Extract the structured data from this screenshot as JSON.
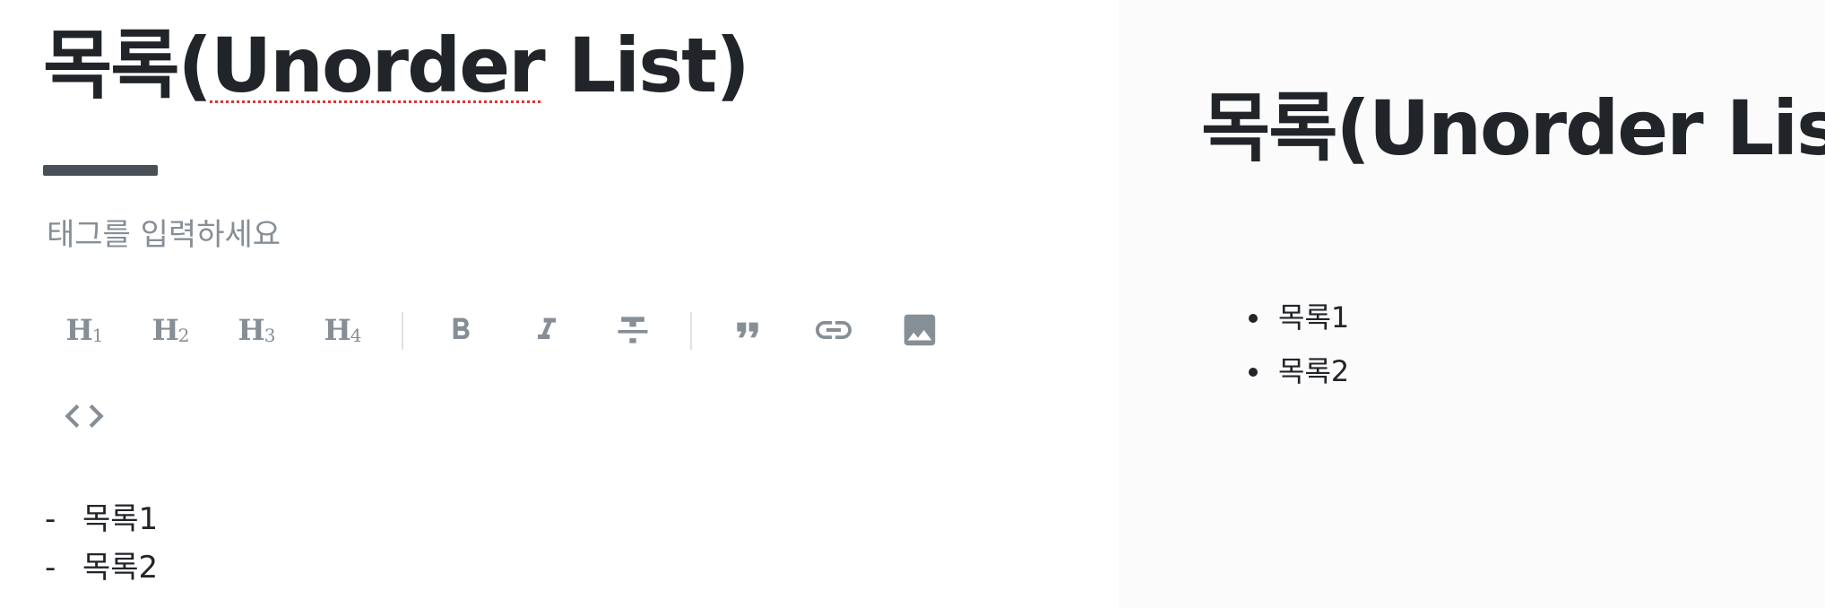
{
  "editor": {
    "title": "목록(Unorder List)",
    "title_prefix": "목록(",
    "title_misspelled": "Unorder",
    "title_suffix": " List)",
    "tag_placeholder": "태그를 입력하세요",
    "toolbar": {
      "heading1": {
        "letter": "H",
        "level": "1"
      },
      "heading2": {
        "letter": "H",
        "level": "2"
      },
      "heading3": {
        "letter": "H",
        "level": "3"
      },
      "heading4": {
        "letter": "H",
        "level": "4"
      },
      "bold_icon": "bold-icon",
      "italic_icon": "italic-icon",
      "strikethrough_icon": "strikethrough-icon",
      "quote_icon": "quote-icon",
      "link_icon": "link-icon",
      "image_icon": "image-icon",
      "code_icon": "code-icon"
    },
    "content_lines": [
      {
        "marker": "-",
        "text": "목록1"
      },
      {
        "marker": "-",
        "text": "목록2"
      }
    ]
  },
  "preview": {
    "title": "목록(Unorder List)",
    "list_items": [
      "목록1",
      "목록2"
    ]
  },
  "colors": {
    "text": "#212529",
    "muted": "#868e96",
    "title_bar": "#495057",
    "preview_bg": "#fbfbfc",
    "divider": "#dee2e6",
    "spellcheck": "#e03131"
  }
}
